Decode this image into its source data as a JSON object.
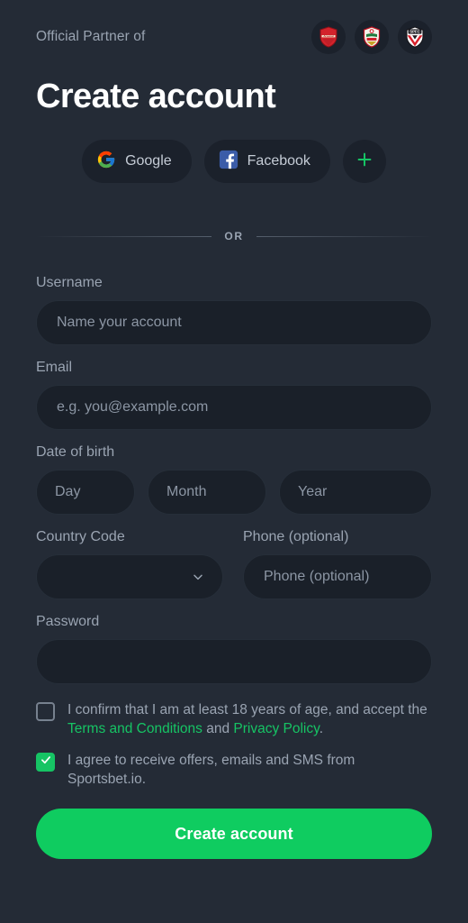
{
  "theme": {
    "background": "#242b36",
    "input_bg": "#1a2029",
    "surface": "#1b212b",
    "accent_green": "#0fcc60",
    "check_green": "#16c464",
    "label_gray": "#9aa4b2",
    "title_white": "#ffffff"
  },
  "partner": {
    "label": "Official Partner of",
    "badges": [
      {
        "name": "arsenal-badge",
        "text": "Arsenal"
      },
      {
        "name": "southampton-badge",
        "text": "Southampton"
      },
      {
        "name": "sao-paulo-badge",
        "text": "SPFC"
      }
    ]
  },
  "header": {
    "title": "Create account"
  },
  "social": {
    "google_label": "Google",
    "facebook_label": "Facebook",
    "more_label": "+"
  },
  "divider": {
    "text": "OR"
  },
  "form": {
    "username": {
      "label": "Username",
      "placeholder": "Name your account",
      "value": ""
    },
    "email": {
      "label": "Email",
      "placeholder": "e.g. you@example.com",
      "value": ""
    },
    "dob": {
      "label": "Date of birth",
      "day_placeholder": "Day",
      "month_placeholder": "Month",
      "year_placeholder": "Year",
      "day_value": "",
      "month_value": "",
      "year_value": ""
    },
    "country_code": {
      "label": "Country Code",
      "value": "",
      "placeholder": ""
    },
    "phone": {
      "label": "Phone (optional)",
      "placeholder": "Phone (optional)",
      "value": ""
    },
    "password": {
      "label": "Password",
      "placeholder": "",
      "value": ""
    }
  },
  "consents": {
    "age": {
      "checked": false,
      "text_before": "I confirm that I am at least 18 years of age, and accept the ",
      "terms_link": "Terms and Conditions",
      "text_between": " and ",
      "privacy_link": "Privacy Policy",
      "text_after": "."
    },
    "marketing": {
      "checked": true,
      "text": "I agree to receive offers, emails and SMS from Sportsbet.io."
    }
  },
  "submit": {
    "label": "Create account"
  }
}
